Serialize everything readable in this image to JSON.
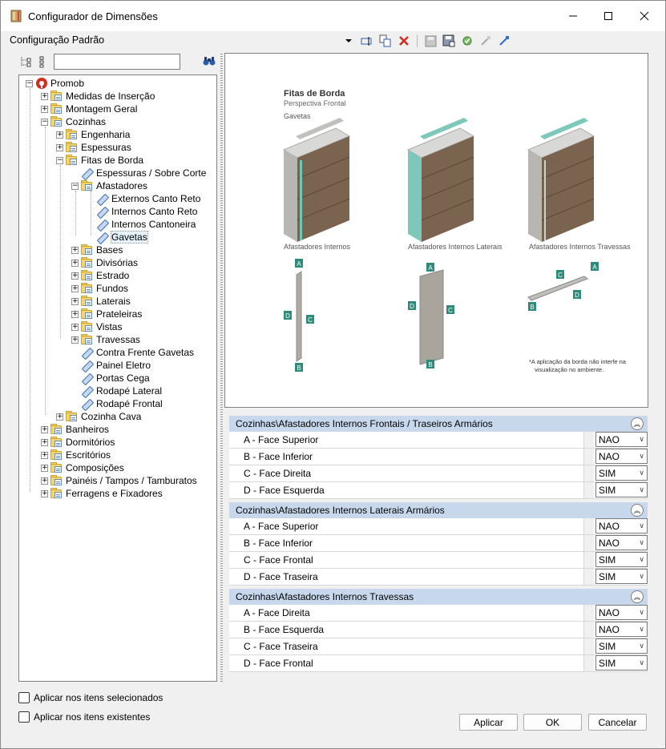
{
  "window": {
    "title": "Configurador de Dimensões"
  },
  "toolbar": {
    "config_label": "Configuração Padrão"
  },
  "search": {
    "value": ""
  },
  "tree": {
    "nodes": [
      {
        "label": "Promob"
      },
      {
        "label": "Medidas de Inserção"
      },
      {
        "label": "Montagem Geral"
      },
      {
        "label": "Cozinhas"
      },
      {
        "label": "Engenharia"
      },
      {
        "label": "Espessuras"
      },
      {
        "label": "Fitas de Borda"
      },
      {
        "label": "Espessuras / Sobre Corte"
      },
      {
        "label": "Afastadores"
      },
      {
        "label": "Externos Canto Reto"
      },
      {
        "label": "Internos Canto Reto"
      },
      {
        "label": "Internos Cantoneira"
      },
      {
        "label": "Gavetas"
      },
      {
        "label": "Bases"
      },
      {
        "label": "Divisórias"
      },
      {
        "label": "Estrado"
      },
      {
        "label": "Fundos"
      },
      {
        "label": "Laterais"
      },
      {
        "label": "Prateleiras"
      },
      {
        "label": "Vistas"
      },
      {
        "label": "Travessas"
      },
      {
        "label": "Contra Frente Gavetas"
      },
      {
        "label": "Painel Eletro"
      },
      {
        "label": "Portas Cega"
      },
      {
        "label": "Rodapé Lateral"
      },
      {
        "label": "Rodapé Frontal"
      },
      {
        "label": "Cozinha Cava"
      },
      {
        "label": "Banheiros"
      },
      {
        "label": "Dormitórios"
      },
      {
        "label": "Escritórios"
      },
      {
        "label": "Composições"
      },
      {
        "label": "Painéis / Tampos / Tamburatos"
      },
      {
        "label": "Ferragens e Fixadores"
      }
    ]
  },
  "options": {
    "apply_selected": "Aplicar nos itens selecionados",
    "apply_existing": "Aplicar nos itens existentes"
  },
  "illustration": {
    "title": "Fitas de Borda",
    "subtitle": "Perspectiva Frontal",
    "section": "Gavetas",
    "captions": [
      "Afastadores Internos",
      "Afastadores Internos Laterais",
      "Afastadores Internos Travessas"
    ],
    "letters": {
      "a": "A",
      "b": "B",
      "c": "C",
      "d": "D"
    },
    "note_line1": "*A aplicação da borda não interfe na",
    "note_line2": "visualização no ambiente.",
    "teal": "#2e8b7a"
  },
  "groups": [
    {
      "title": "Cozinhas\\Afastadores Internos Frontais / Traseiros Armários",
      "rows": [
        {
          "name": "A - Face Superior",
          "value": "NAO"
        },
        {
          "name": "B - Face Inferior",
          "value": "NAO"
        },
        {
          "name": "C - Face Direita",
          "value": "SIM"
        },
        {
          "name": "D - Face Esquerda",
          "value": "SIM"
        }
      ]
    },
    {
      "title": "Cozinhas\\Afastadores Internos Laterais Armários",
      "rows": [
        {
          "name": "A - Face Superior",
          "value": "NAO"
        },
        {
          "name": "B - Face Inferior",
          "value": "NAO"
        },
        {
          "name": "C - Face Frontal",
          "value": "SIM"
        },
        {
          "name": "D - Face Traseira",
          "value": "SIM"
        }
      ]
    },
    {
      "title": "Cozinhas\\Afastadores Internos Travessas",
      "rows": [
        {
          "name": "A - Face Direita",
          "value": "NAO"
        },
        {
          "name": "B - Face Esquerda",
          "value": "NAO"
        },
        {
          "name": "C - Face Traseira",
          "value": "SIM"
        },
        {
          "name": "D - Face Frontal",
          "value": "SIM"
        }
      ]
    }
  ],
  "buttons": {
    "apply": "Aplicar",
    "ok": "OK",
    "cancel": "Cancelar"
  },
  "colors": {
    "header_bg": "#c7d8ed",
    "window_bg": "#f0f0f0",
    "accent_red": "#d42b1e"
  }
}
